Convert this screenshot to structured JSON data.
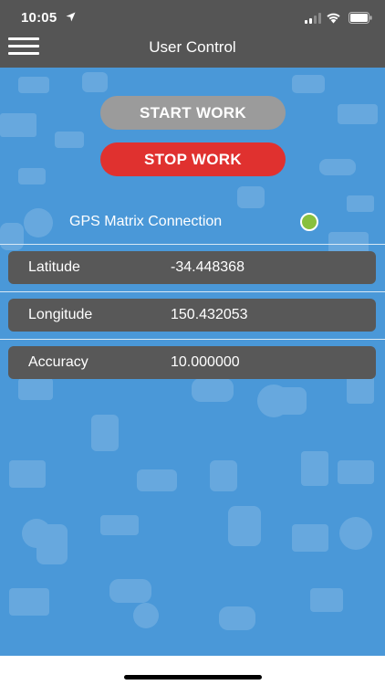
{
  "status_bar": {
    "time": "10:05"
  },
  "nav": {
    "title": "User Control"
  },
  "buttons": {
    "start": "START WORK",
    "stop": "STOP WORK"
  },
  "gps": {
    "label": "GPS Matrix Connection",
    "status_color": "#88c03e"
  },
  "rows": [
    {
      "label": "Latitude",
      "value": "-34.448368"
    },
    {
      "label": "Longitude",
      "value": "150.432053"
    },
    {
      "label": "Accuracy",
      "value": "10.000000"
    }
  ],
  "colors": {
    "bar": "#555555",
    "background": "#4a98d8",
    "start_button": "#9b9b9b",
    "stop_button": "#e0312f",
    "row": "#585858"
  }
}
